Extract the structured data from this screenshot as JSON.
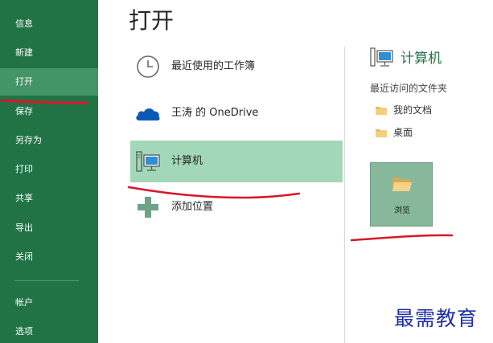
{
  "sidebar": {
    "items": [
      {
        "label": "信息"
      },
      {
        "label": "新建"
      },
      {
        "label": "打开"
      },
      {
        "label": "保存"
      },
      {
        "label": "另存为"
      },
      {
        "label": "打印"
      },
      {
        "label": "共享"
      },
      {
        "label": "导出"
      },
      {
        "label": "关闭"
      },
      {
        "label": "帐户"
      },
      {
        "label": "选项"
      }
    ],
    "active": "打开"
  },
  "page": {
    "title": "打开"
  },
  "places": [
    {
      "label": "最近使用的工作簿",
      "icon": "clock-icon"
    },
    {
      "label": "王涛 的 OneDrive",
      "icon": "cloud-icon"
    },
    {
      "label": "计算机",
      "icon": "computer-icon"
    },
    {
      "label": "添加位置",
      "icon": "plus-icon"
    }
  ],
  "panel": {
    "title": "计算机",
    "recent_label": "最近访问的文件夹",
    "folders": [
      {
        "label": "我的文档"
      },
      {
        "label": "桌面"
      }
    ],
    "browse_label": "浏览"
  },
  "watermark": "最需教育",
  "colors": {
    "sidebar": "#217346",
    "sidebar_active": "#439467",
    "selected_place": "#a3d7b9",
    "browse_button": "#88b89c",
    "accent": "#217346",
    "annotation": "#d9162a",
    "watermark": "#1f2fa8"
  }
}
